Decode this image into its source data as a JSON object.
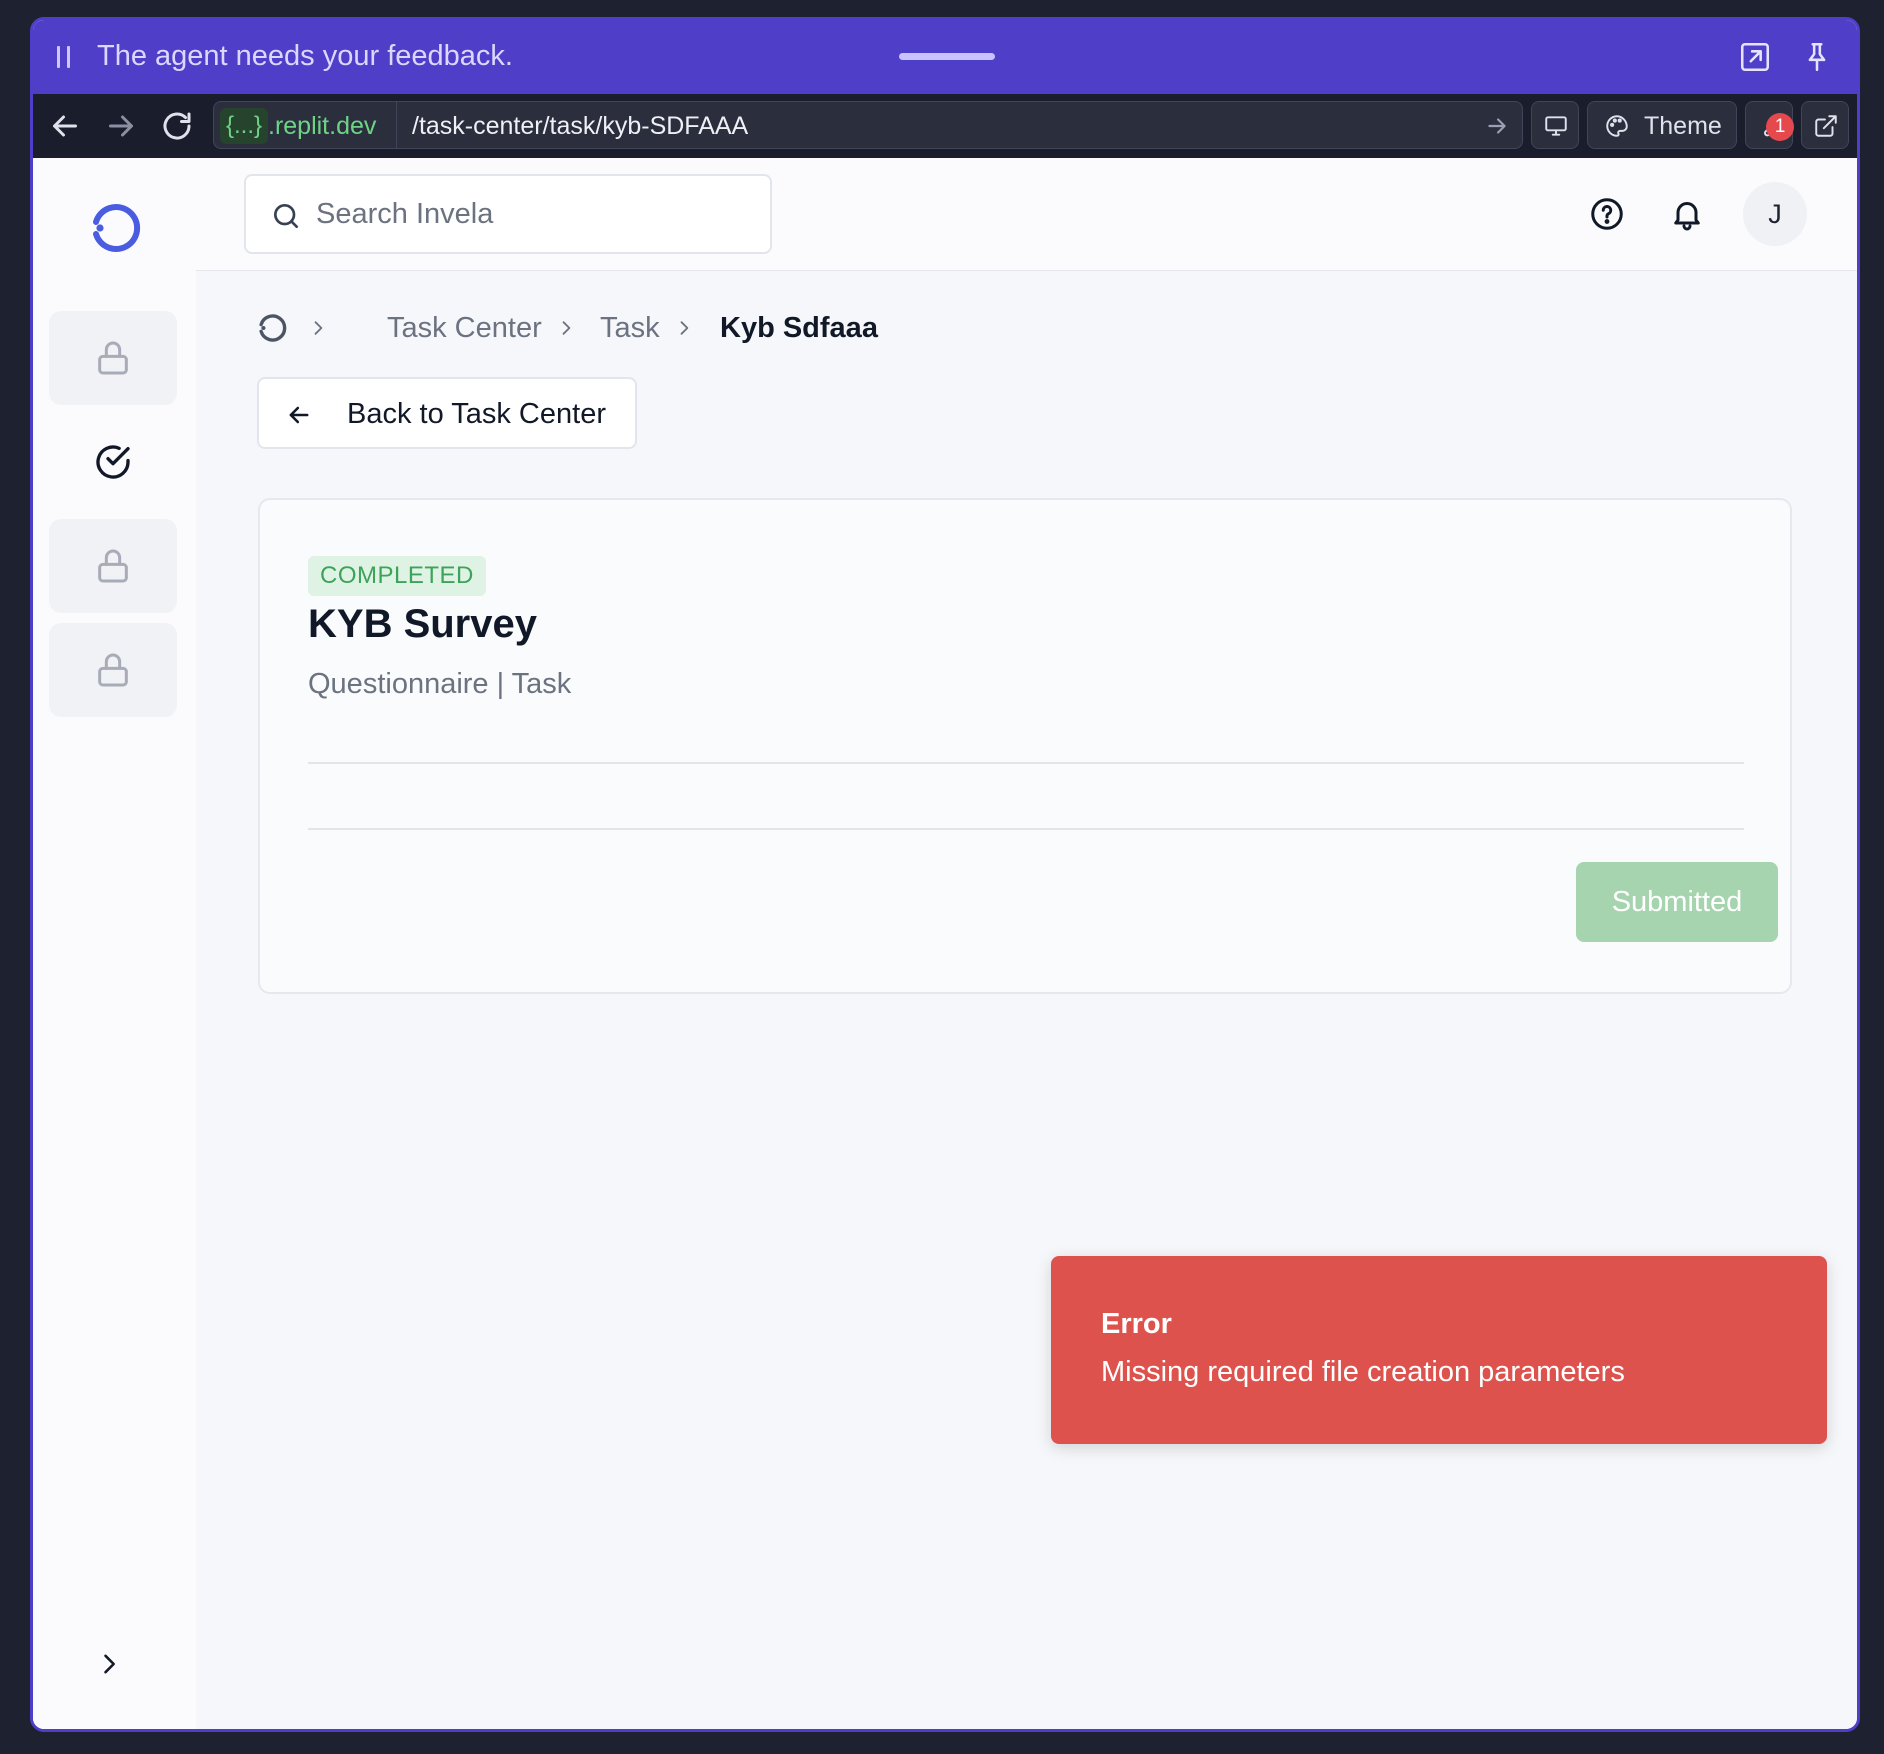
{
  "agent_bar": {
    "message": "The agent needs your feedback."
  },
  "browser": {
    "url_tag": "{...}",
    "url_domain": ".replit.dev",
    "url_path": "/task-center/task/kyb-SDFAAA",
    "theme_label": "Theme",
    "devtools_badge": "1"
  },
  "search": {
    "placeholder": "Search Invela"
  },
  "user": {
    "initial": "J"
  },
  "breadcrumb": {
    "items": [
      "Task Center",
      "Task",
      "Kyb Sdfaaa"
    ]
  },
  "back_button": {
    "label": "Back to Task Center"
  },
  "task": {
    "status": "COMPLETED",
    "title": "KYB Survey",
    "subtitle": "Questionnaire | Task",
    "action_label": "Submitted"
  },
  "toast": {
    "title": "Error",
    "message": "Missing required file creation parameters"
  },
  "colors": {
    "agent_bar": "#4f3fc8",
    "accent": "#4a5ce0",
    "status_green": "#3ea35a",
    "toast_red": "#dd524c"
  }
}
